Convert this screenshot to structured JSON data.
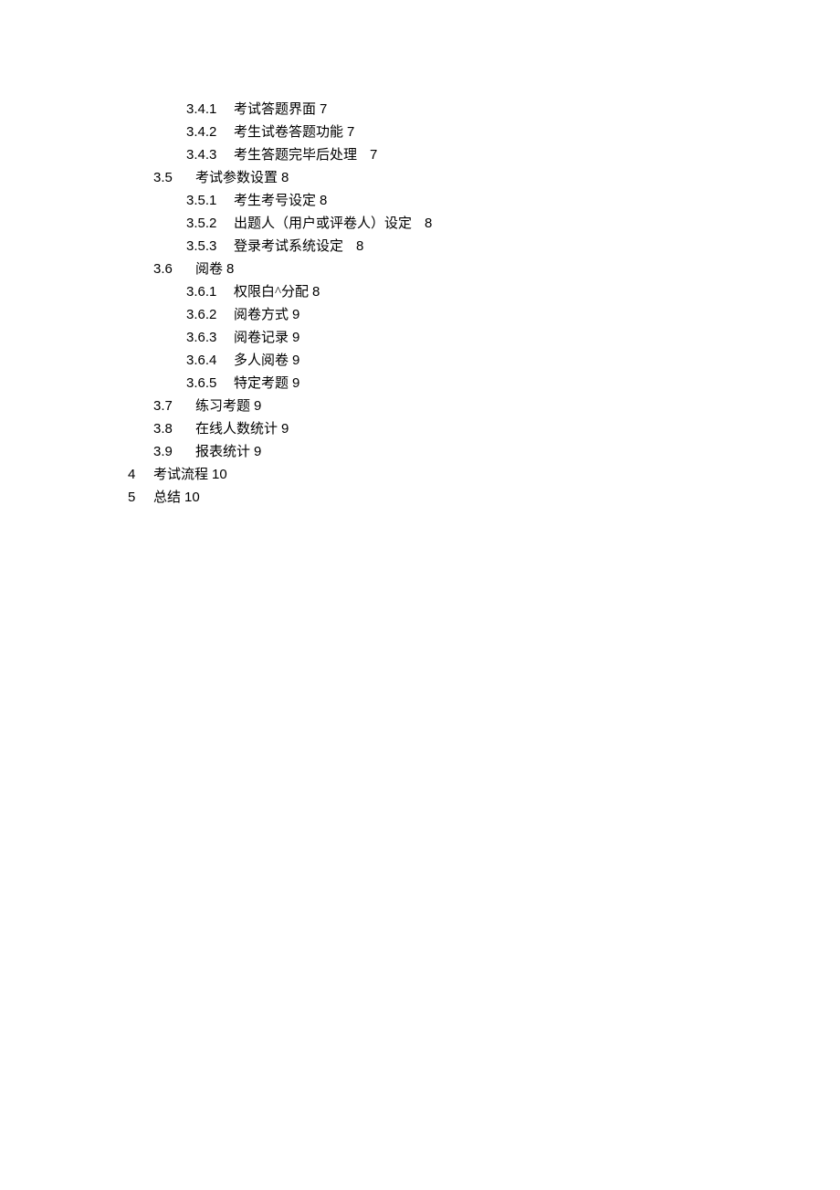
{
  "toc": [
    {
      "level": 3,
      "num": "3.4.1",
      "title": "考试答题界面",
      "page": "7",
      "spaced": false
    },
    {
      "level": 3,
      "num": "3.4.2",
      "title": "考生试卷答题功能",
      "page": "7",
      "spaced": false
    },
    {
      "level": 3,
      "num": "3.4.3",
      "title": "考生答题完毕后处理",
      "page": "7",
      "spaced": true
    },
    {
      "level": 2,
      "num": "3.5",
      "title": "考试参数设置",
      "page": "8",
      "spaced": false
    },
    {
      "level": 3,
      "num": "3.5.1",
      "title": "考生考号设定",
      "page": "8",
      "spaced": false
    },
    {
      "level": 3,
      "num": "3.5.2",
      "title": "出题人（用户或评卷人）设定",
      "page": "8",
      "spaced": true
    },
    {
      "level": 3,
      "num": "3.5.3",
      "title": "登录考试系统设定",
      "page": "8",
      "spaced": true
    },
    {
      "level": 2,
      "num": "3.6",
      "title": "阅卷",
      "page": "8",
      "spaced": false
    },
    {
      "level": 3,
      "num": "3.6.1",
      "title": "权限白^分配",
      "page": "8",
      "spaced": false
    },
    {
      "level": 3,
      "num": "3.6.2",
      "title": "阅卷方式",
      "page": "9",
      "spaced": false
    },
    {
      "level": 3,
      "num": "3.6.3",
      "title": "阅卷记录",
      "page": "9",
      "spaced": false
    },
    {
      "level": 3,
      "num": "3.6.4",
      "title": "多人阅卷",
      "page": "9",
      "spaced": false
    },
    {
      "level": 3,
      "num": "3.6.5",
      "title": "特定考题",
      "page": "9",
      "spaced": false
    },
    {
      "level": 2,
      "num": "3.7",
      "title": "练习考题",
      "page": "9",
      "spaced": false
    },
    {
      "level": 2,
      "num": "3.8",
      "title": "在线人数统计",
      "page": "9",
      "spaced": false
    },
    {
      "level": 2,
      "num": "3.9",
      "title": "报表统计",
      "page": "9",
      "spaced": false
    },
    {
      "level": 1,
      "num": "4",
      "title": "考试流程",
      "page": "10",
      "spaced": false
    },
    {
      "level": 1,
      "num": "5",
      "title": "总结",
      "page": "10",
      "spaced": false
    }
  ]
}
